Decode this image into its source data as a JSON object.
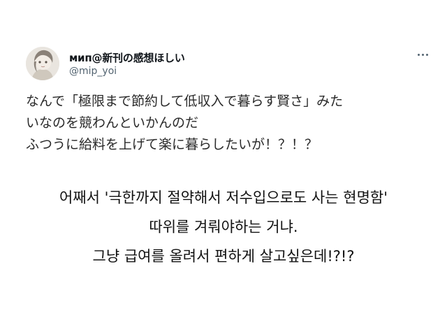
{
  "tweet": {
    "user": {
      "display_name": "мип@新刊の感想ほしい",
      "handle": "@mip_yoi",
      "avatar_icon": "user-avatar"
    },
    "more_icon": "more-horizontal-icon",
    "text_lines": [
      "なんで「極限まで節約して低収入で暮らす賢さ」みた",
      "いなのを競わんといかんのだ",
      "ふつうに給料を上げて楽に暮らしたいが！？！？"
    ]
  },
  "translation": {
    "lines": [
      "어째서 '극한까지 절약해서 저수입으로도 사는 현명함'",
      "따위를 겨뤄야하는 거냐.",
      "그냥 급여를 올려서 편하게 살고싶은데!?!?"
    ]
  }
}
